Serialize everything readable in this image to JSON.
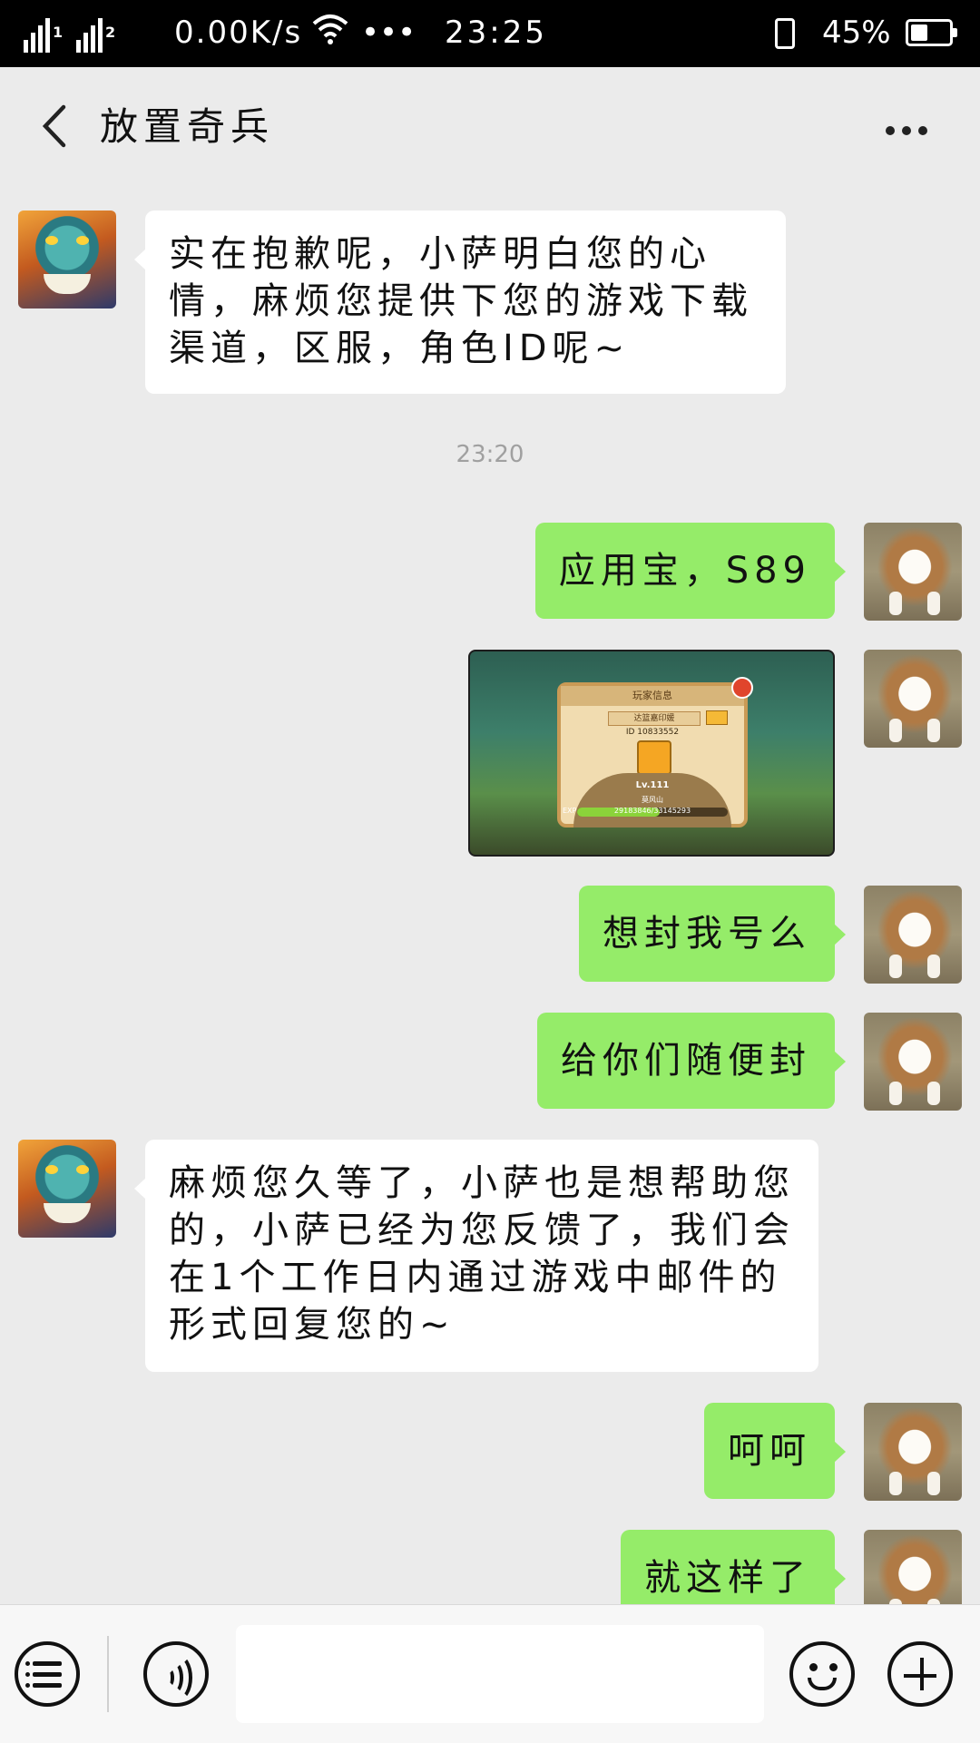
{
  "status_bar": {
    "sim1_label": "1",
    "sim2_label": "2",
    "net_speed": "0.00K/s",
    "dots": "•••",
    "time": "23:25",
    "battery_text": "45%",
    "battery_level": 0.45
  },
  "header": {
    "title": "放置奇兵",
    "back_icon": "chevron-left-icon",
    "more_icon": "more-icon"
  },
  "messages": [
    {
      "side": "in",
      "avatar": "dragon-avatar",
      "text": "实在抱歉呢，小萨明白您的心情，麻烦您提供下您的游戏下载渠道，区服，角色ID呢~"
    },
    {
      "side": "timestamp",
      "text": "23:20"
    },
    {
      "side": "out",
      "avatar": "dog-avatar",
      "text": "应用宝，S89"
    },
    {
      "side": "out",
      "avatar": "dog-avatar",
      "type": "image"
    },
    {
      "side": "out",
      "avatar": "dog-avatar",
      "text": "想封我号么"
    },
    {
      "side": "out",
      "avatar": "dog-avatar",
      "text": "给你们随便封"
    },
    {
      "side": "in",
      "avatar": "dragon-avatar",
      "text": "麻烦您久等了，小萨也是想帮助您的，小萨已经为您反馈了，我们会在1个工作日内通过游戏中邮件的形式回复您的~"
    },
    {
      "side": "out",
      "avatar": "dog-avatar",
      "text": "呵呵"
    },
    {
      "side": "out",
      "avatar": "dog-avatar",
      "text": "就这样了"
    }
  ],
  "game_screenshot": {
    "panel_title": "玩家信息",
    "player_name": "达篮嘉印媛",
    "player_id": "ID 10833552",
    "level": "Lv.111",
    "server": "莫风山",
    "exp_label": "EXP",
    "exp_value": "29183846/33145293",
    "exp_fraction": 0.55
  },
  "input_bar": {
    "menu_icon": "menu-list-icon",
    "voice_icon": "voice-icon",
    "input_value": "",
    "emoji_icon": "emoji-icon",
    "add_icon": "plus-icon"
  }
}
